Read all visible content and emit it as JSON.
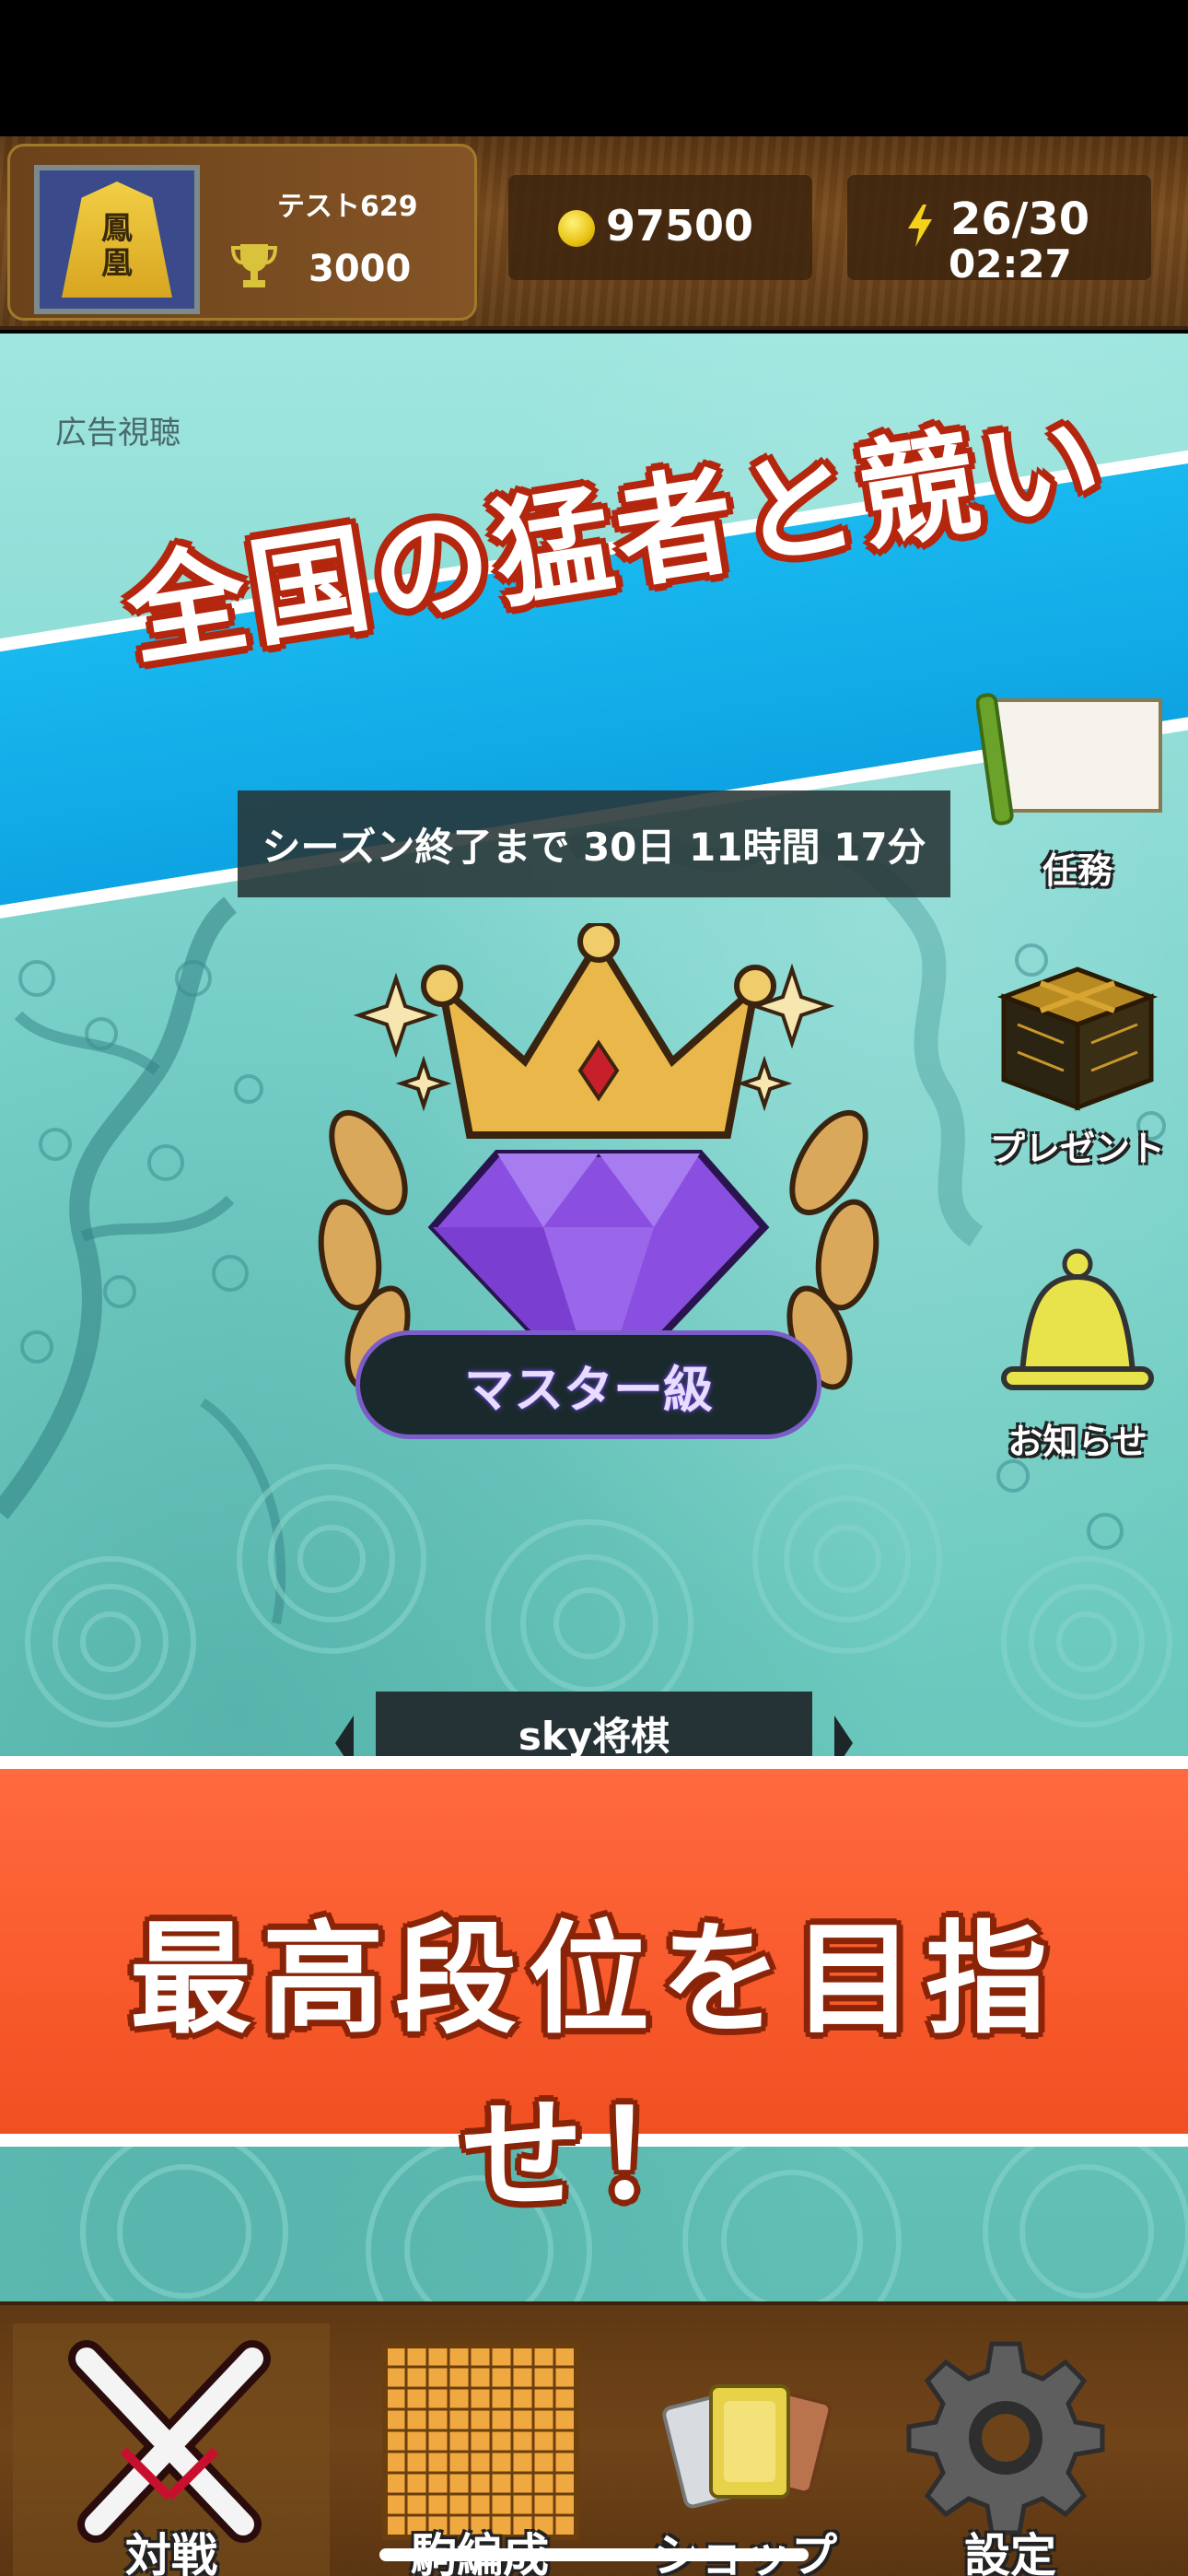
{
  "header": {
    "avatar_piece_chars": [
      "鳳",
      "凰"
    ],
    "player_name": "テスト629",
    "trophy_score": "3000",
    "coins": "97500",
    "stamina": "26/30",
    "stamina_timer": "02:27"
  },
  "main": {
    "ad_label": "広告視聴",
    "top_banner": "全国の猛者と競い",
    "season_remaining": "シーズン終了まで 30日 11時間 17分",
    "rank": "マスター級",
    "side_buttons": {
      "mission": "任務",
      "present": "プレゼント",
      "notice": "お知らせ"
    },
    "opponent_name": "sky将棋",
    "bottom_banner": "最高段位を目指せ！"
  },
  "nav": {
    "items": [
      {
        "label": "対戦",
        "icon": "crossed-swords-icon",
        "active": true
      },
      {
        "label": "駒編成",
        "icon": "shogi-board-icon",
        "active": false
      },
      {
        "label": "ショップ",
        "icon": "cards-icon",
        "active": false
      },
      {
        "label": "設定",
        "icon": "gear-icon",
        "active": false
      }
    ]
  },
  "colors": {
    "accent_blue": "#12aee9",
    "accent_orange": "#f85a2c",
    "header_wood": "#6b421a"
  }
}
